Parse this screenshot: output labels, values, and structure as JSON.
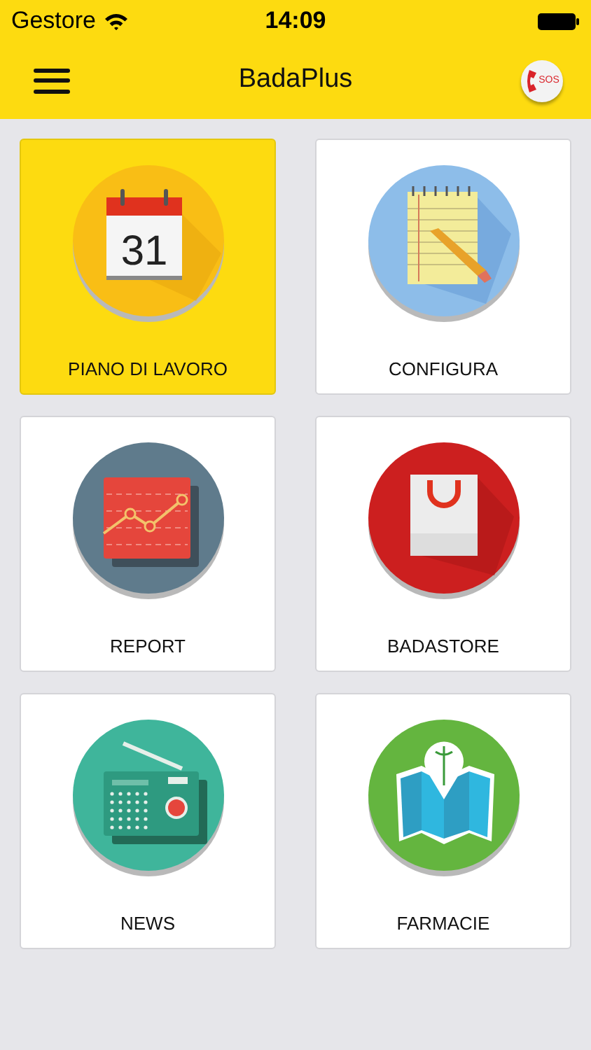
{
  "status_bar": {
    "carrier": "Gestore",
    "time": "14:09"
  },
  "nav_bar": {
    "title": "BadaPlus",
    "sos_label": "SOS"
  },
  "tiles": [
    {
      "label": "PIANO DI LAVORO",
      "kind": "calendar",
      "icon_text": "31",
      "selected": true
    },
    {
      "label": "CONFIGURA",
      "kind": "notepad",
      "selected": false
    },
    {
      "label": "REPORT",
      "kind": "chart",
      "selected": false
    },
    {
      "label": "BADASTORE",
      "kind": "bag",
      "selected": false
    },
    {
      "label": "NEWS",
      "kind": "radio",
      "selected": false
    },
    {
      "label": "FARMACIE",
      "kind": "map",
      "selected": false
    }
  ]
}
